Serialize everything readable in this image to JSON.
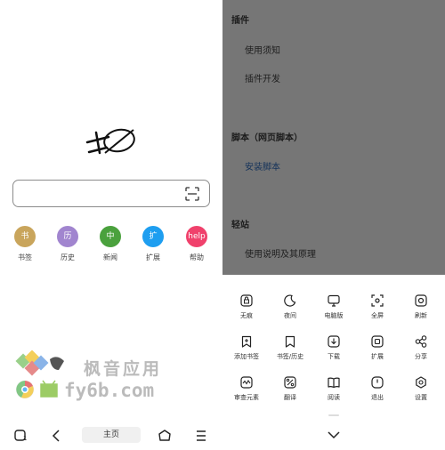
{
  "home": {
    "search": {
      "placeholder": "",
      "scan_icon": "scan-icon"
    },
    "shortcuts": [
      {
        "key": "bookmarks",
        "badge": "书",
        "label": "书签",
        "color": "#c9a55c"
      },
      {
        "key": "history",
        "badge": "历",
        "label": "历史",
        "color": "#a185cf"
      },
      {
        "key": "news",
        "badge": "中",
        "label": "新闻",
        "color": "#4aa13d"
      },
      {
        "key": "extensions",
        "badge": "扩",
        "label": "扩展",
        "color": "#1e9ef0"
      },
      {
        "key": "help",
        "badge": "help",
        "label": "帮助",
        "color": "#f0416c"
      }
    ],
    "watermark": {
      "line1": "枫音应用",
      "line2": "fy6b.com"
    },
    "bottom_bar": {
      "tab_count": "1",
      "home_label": "主页"
    }
  },
  "menu": {
    "sections": [
      {
        "key": "plugins",
        "title": "插件",
        "items": [
          {
            "label": "使用须知",
            "link": false
          },
          {
            "label": "插件开发",
            "link": false
          }
        ]
      },
      {
        "key": "scripts",
        "title": "脚本（网页脚本）",
        "items": [
          {
            "label": "安装脚本",
            "link": true
          }
        ]
      },
      {
        "key": "light",
        "title": "轻站",
        "items": [
          {
            "label": "使用说明及其原理",
            "link": false
          }
        ]
      }
    ],
    "actions": [
      {
        "label": "无痕",
        "icon": "incognito-icon"
      },
      {
        "label": "夜间",
        "icon": "moon-icon"
      },
      {
        "label": "电脑版",
        "icon": "desktop-icon"
      },
      {
        "label": "全屏",
        "icon": "fullscreen-icon"
      },
      {
        "label": "刷新",
        "icon": "refresh-icon"
      },
      {
        "label": "添加书签",
        "icon": "add-bookmark-icon"
      },
      {
        "label": "书签/历史",
        "icon": "bookmark-icon"
      },
      {
        "label": "下载",
        "icon": "download-icon"
      },
      {
        "label": "扩展",
        "icon": "extension-icon"
      },
      {
        "label": "分享",
        "icon": "share-icon"
      },
      {
        "label": "审查元素",
        "icon": "inspect-icon"
      },
      {
        "label": "翻译",
        "icon": "translate-icon"
      },
      {
        "label": "阅读",
        "icon": "book-icon"
      },
      {
        "label": "退出",
        "icon": "power-icon"
      },
      {
        "label": "设置",
        "icon": "settings-icon"
      }
    ]
  }
}
